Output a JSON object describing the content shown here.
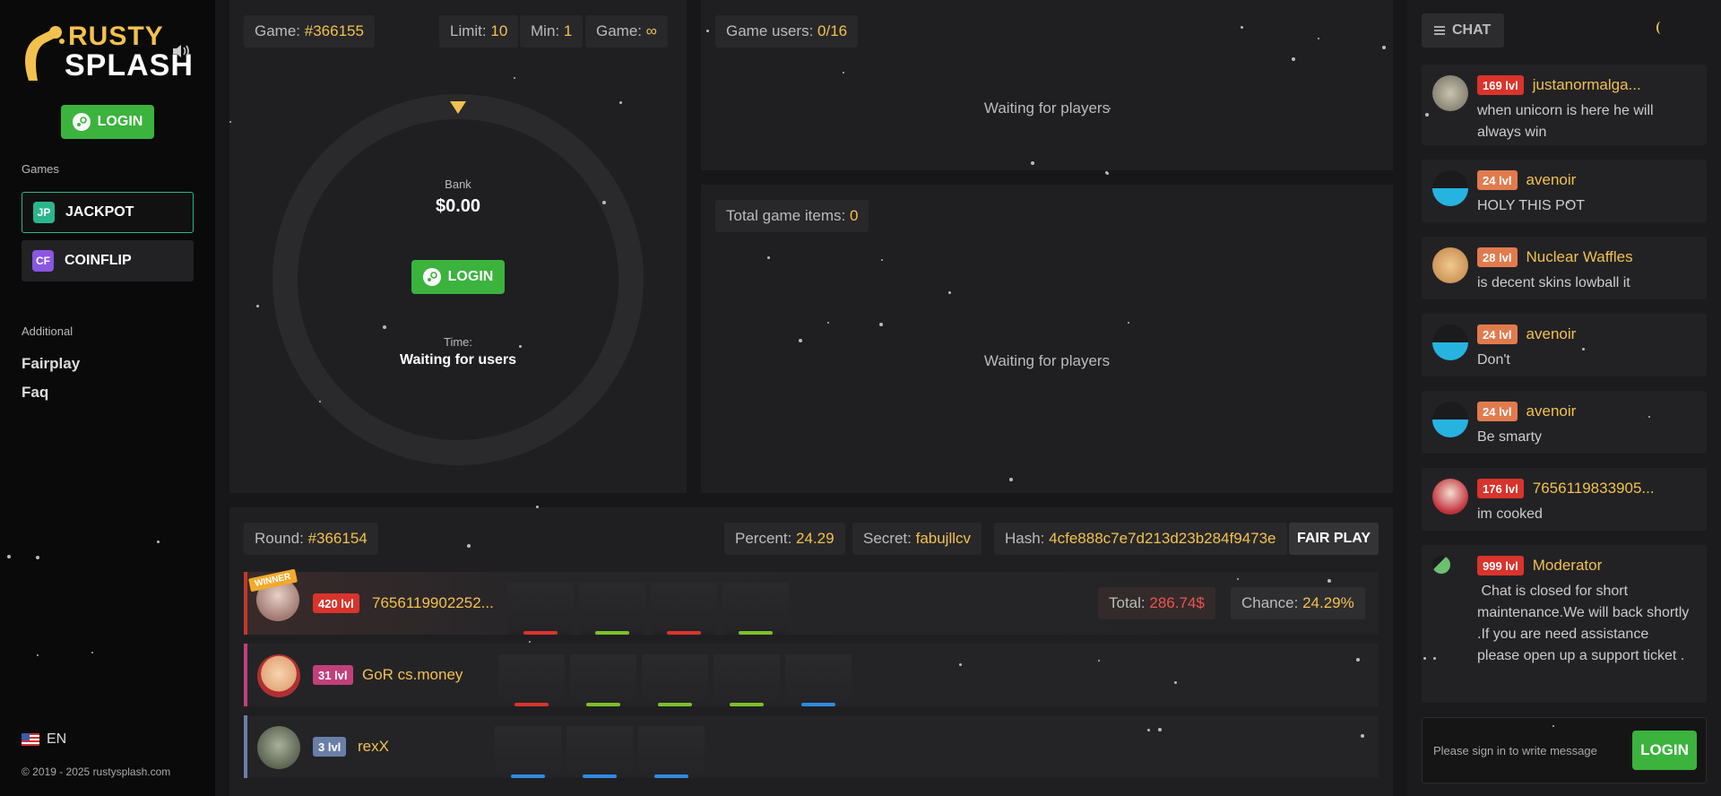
{
  "brand": {
    "line1": "RUSTY",
    "line2": "SPLASH"
  },
  "sidebar": {
    "login_label": "LOGIN",
    "games_heading": "Games",
    "games": [
      {
        "icon": "JP",
        "label": "JACKPOT",
        "color": "#2bb58e"
      },
      {
        "icon": "CF",
        "label": "COINFLIP",
        "color": "#8a56e2"
      }
    ],
    "additional_heading": "Additional",
    "links": [
      "Fairplay",
      "Faq"
    ],
    "language": "EN",
    "copyright": "© 2019 - 2025 rustysplash.com"
  },
  "game": {
    "game_label": "Game:",
    "game_id": "#366155",
    "limit_label": "Limit:",
    "limit": "10",
    "min_label": "Min:",
    "min": "1",
    "game2_label": "Game:",
    "game2_value": "∞",
    "bank_label": "Bank",
    "bank_value": "$0.00",
    "login_label": "LOGIN",
    "time_label": "Time:",
    "time_value": "Waiting for users"
  },
  "users_panel": {
    "label": "Game users:",
    "value": "0/16",
    "waiting": "Waiting for players"
  },
  "items_panel": {
    "label": "Total game items:",
    "value": "0",
    "waiting": "Waiting for players"
  },
  "round": {
    "round_label": "Round:",
    "round_id": "#366154",
    "percent_label": "Percent:",
    "percent": "24.29",
    "secret_label": "Secret:",
    "secret": "fabujllcv",
    "hash_label": "Hash:",
    "hash": "4cfe888c7e7d213d23b284f9473e",
    "fair_play": "FAIR PLAY"
  },
  "players": [
    {
      "winner_badge": "WINNER",
      "level": "420 lvl",
      "name": "7656119902252...",
      "total_label": "Total:",
      "total": "286.74$",
      "chance_label": "Chance:",
      "chance": "24.29%",
      "bar_color": "#c0392b",
      "level_color": "#d9342b",
      "items": [
        "#d9342b",
        "#7cc02a",
        "#d9342b",
        "#7cc02a"
      ]
    },
    {
      "level": "31 lvl",
      "name": "GoR cs.money",
      "bar_color": "#c2407a",
      "level_color": "#c2407a",
      "items": [
        "#d9342b",
        "#7cc02a",
        "#7cc02a",
        "#7cc02a",
        "#2d8be0"
      ]
    },
    {
      "level": "3 lvl",
      "name": "rexX",
      "bar_color": "#6a7fa8",
      "level_color": "#6a7fa8",
      "items": [
        "#2d8be0",
        "#2d8be0",
        "#2d8be0"
      ]
    }
  ],
  "chat": {
    "tab_label": "CHAT",
    "messages": [
      {
        "level": "169 lvl",
        "level_color": "#d9342b",
        "name": "justanormalga...",
        "text": "when unicorn is here he will always win"
      },
      {
        "level": "24 lvl",
        "level_color": "#e07b4e",
        "name": "avenoir",
        "text": "HOLY THIS POT"
      },
      {
        "level": "28 lvl",
        "level_color": "#e07b4e",
        "name": "Nuclear Waffles",
        "text": "is decent skins lowball it"
      },
      {
        "level": "24 lvl",
        "level_color": "#e07b4e",
        "name": "avenoir",
        "text": "Don't"
      },
      {
        "level": "24 lvl",
        "level_color": "#e07b4e",
        "name": "avenoir",
        "text": "Be smarty"
      },
      {
        "level": "176 lvl",
        "level_color": "#d9342b",
        "name": "7656119833905...",
        "text": "im cooked"
      },
      {
        "level": "999 lvl",
        "level_color": "#d9342b",
        "name": "Moderator",
        "text": " Chat is closed for short maintenance.We will back shortly .If you are need assistance please open up a support ticket ."
      }
    ],
    "input_placeholder": "Please sign in to write message",
    "login_label": "LOGIN"
  }
}
